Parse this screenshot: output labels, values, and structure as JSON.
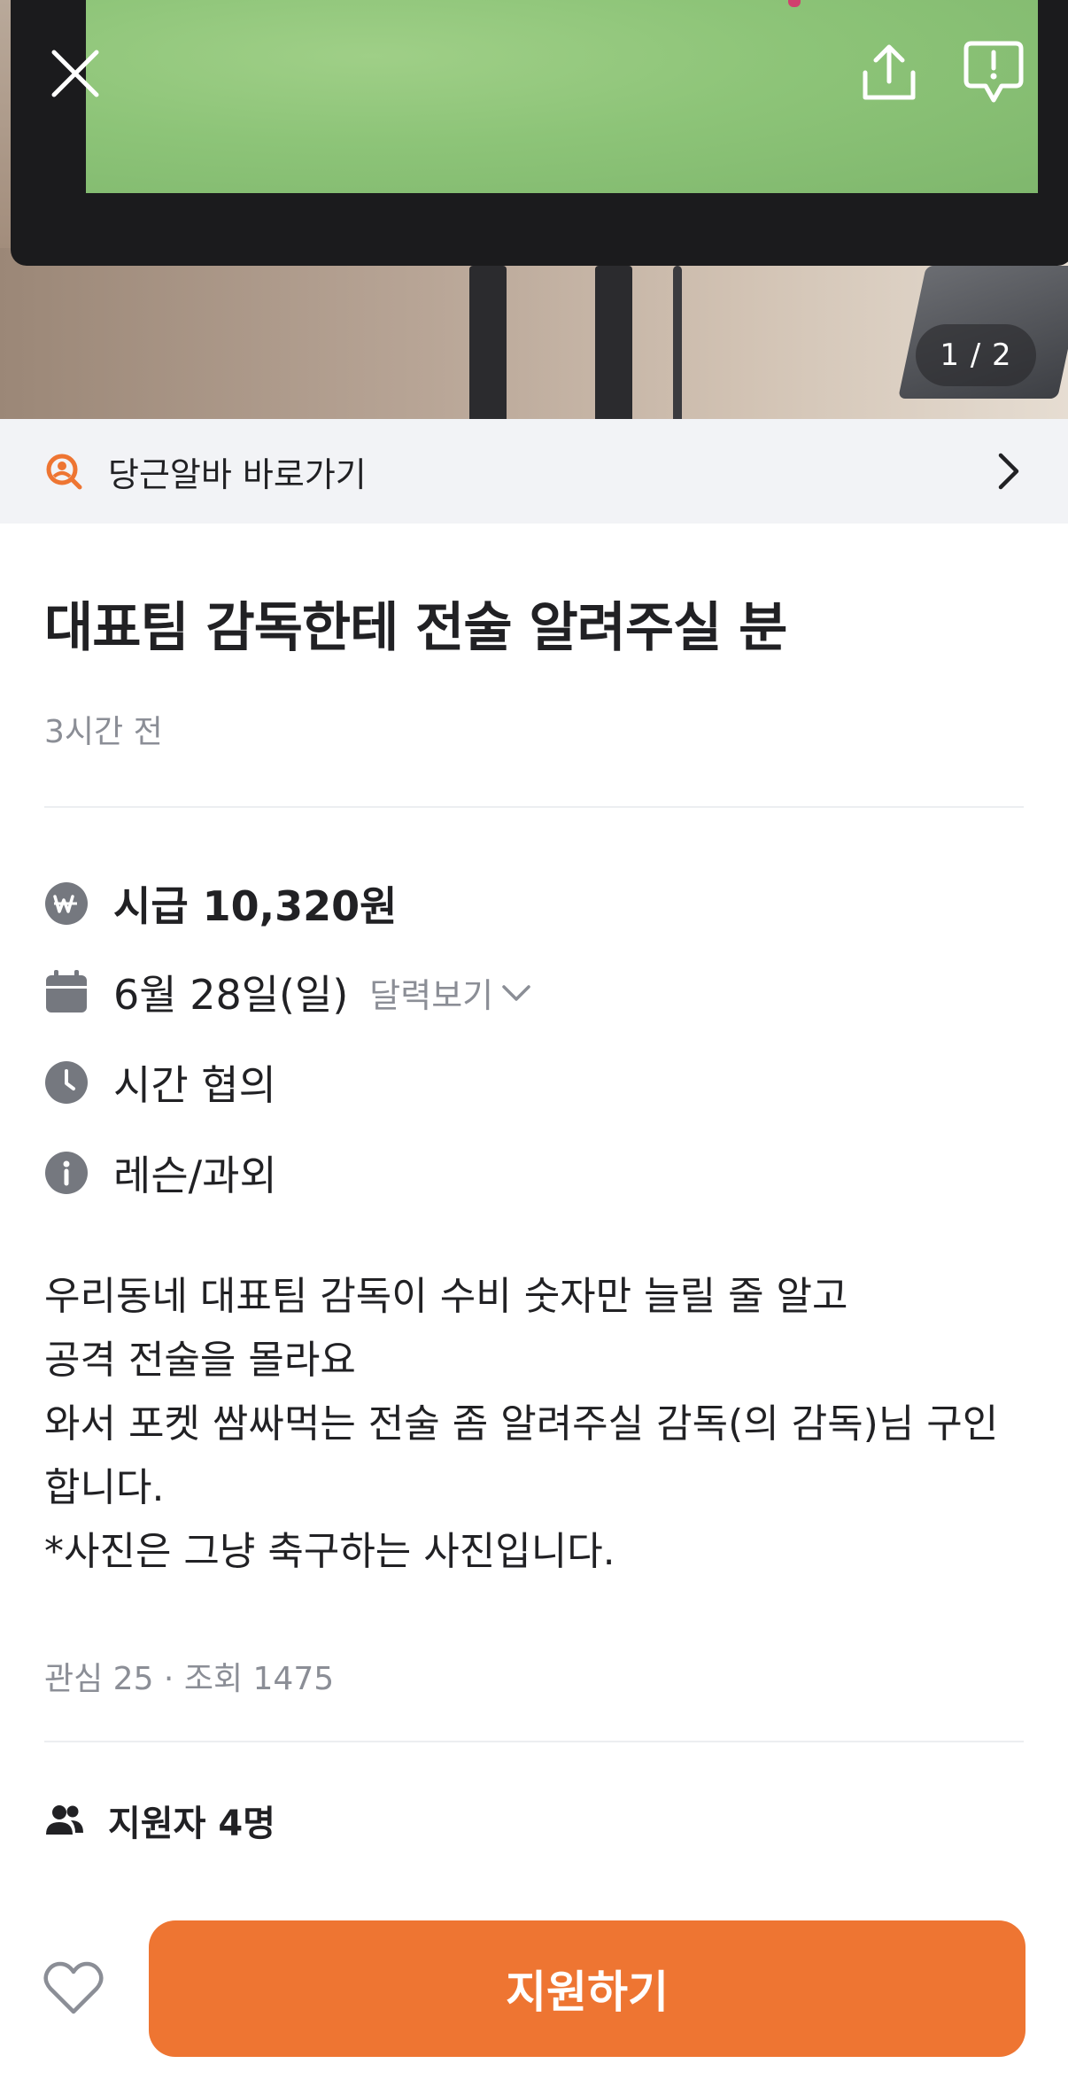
{
  "hero": {
    "image_counter": "1 / 2",
    "close_icon": "close-icon",
    "share_icon": "share-icon",
    "report_icon": "report-icon"
  },
  "banner": {
    "label": "당근알바 바로가기",
    "icon": "alba-search-icon",
    "chevron": "chevron-right-icon"
  },
  "post": {
    "title": "대표팀 감독한테 전술 알려주실 분",
    "posted_time": "3시간 전"
  },
  "info": {
    "wage": "시급 10,320원",
    "date": "6월 28일(일)",
    "calendar_link": "달력보기",
    "time": "시간 협의",
    "category": "레슨/과외"
  },
  "description": {
    "lines": [
      "우리동네 대표팀 감독이 수비 숫자만 늘릴 줄 알고",
      "공격 전술을 몰라요",
      "와서 포켓 쌈싸먹는 전술 좀 알려주실 감독(의 감독)님 구인",
      "합니다.",
      "*사진은 그냥 축구하는 사진입니다."
    ]
  },
  "stats": "관심 25 · 조회 1475",
  "applicants": "지원자 4명",
  "bottom": {
    "apply_label": "지원하기"
  },
  "colors": {
    "accent": "#ee7532",
    "text_primary": "#212124",
    "text_secondary": "#8b8e96",
    "banner_bg": "#f2f3f6",
    "icon_gray": "#75787f"
  }
}
